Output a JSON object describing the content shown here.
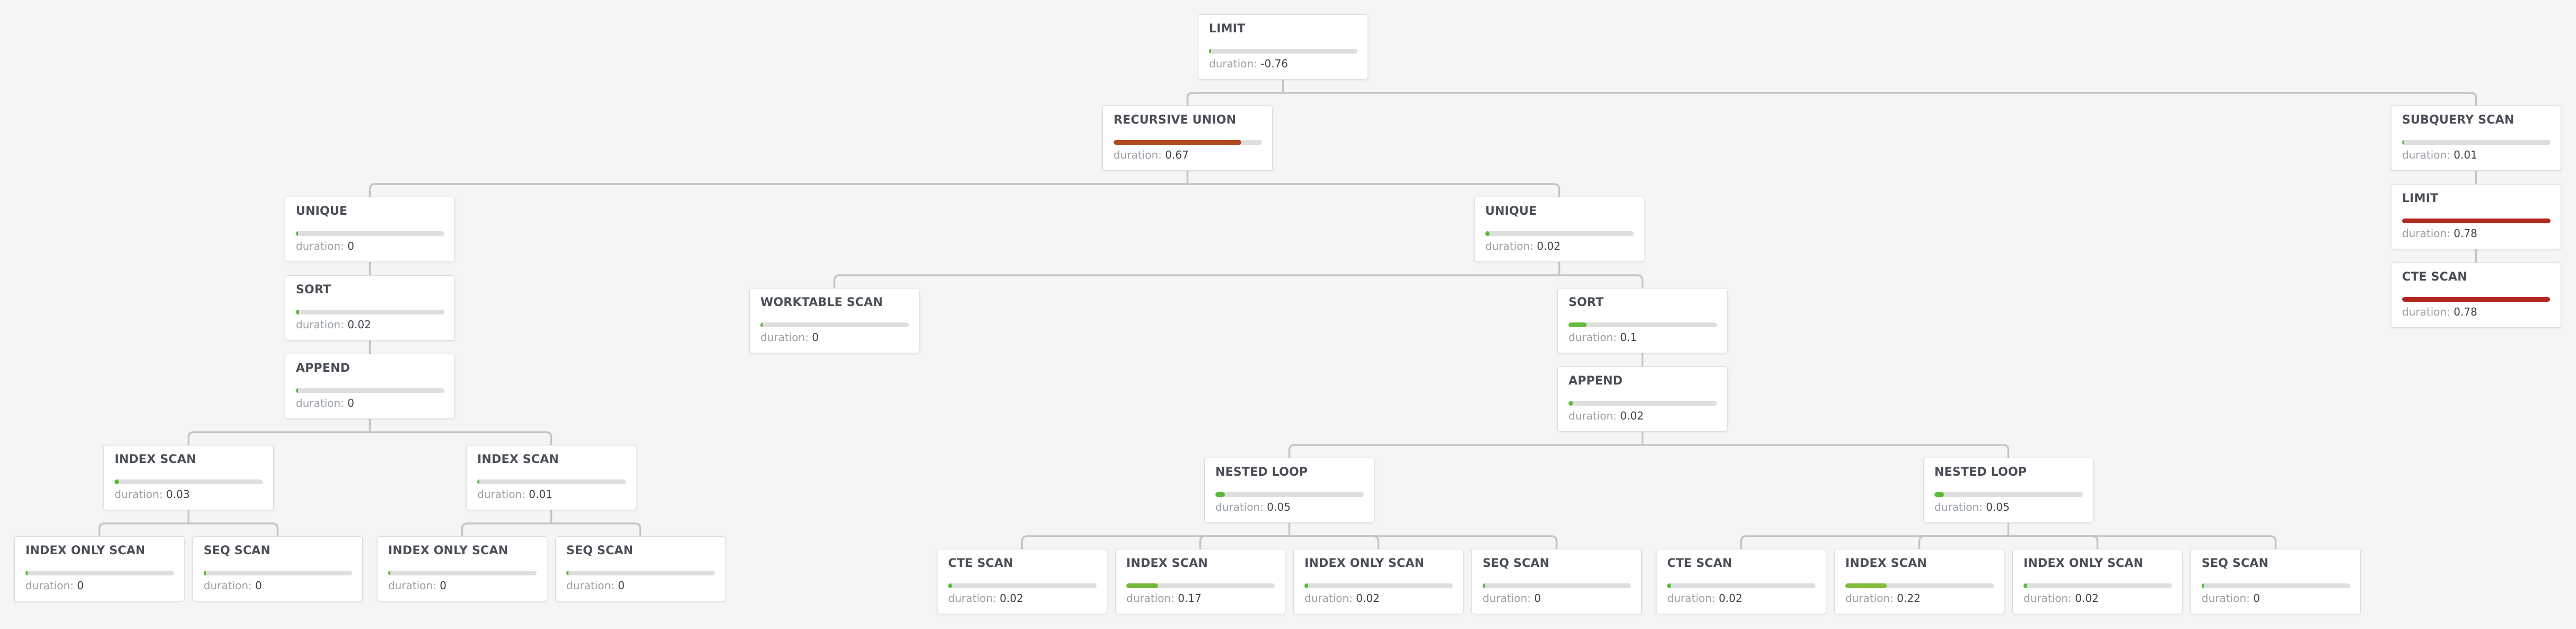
{
  "diagram": {
    "type": "query-plan-tree",
    "duration_label": "duration:",
    "colors": {
      "background": "#f5f5f5",
      "edge": "#c4c4c4",
      "bar_track": "#dedede",
      "bar_low": "#5cba3a",
      "bar_mid_low": "#72b83a",
      "bar_mid": "#84bc3c",
      "bar_high": "#b34a1f",
      "bar_max": "#b0281e"
    },
    "nodes": [
      {
        "id": "limit-root",
        "label": "LIMIT",
        "duration": "-0.76",
        "fraction": 0.0,
        "color": "#5cba3a",
        "parent": null
      },
      {
        "id": "recursive-union",
        "label": "RECURSIVE UNION",
        "duration": "0.67",
        "fraction": 0.86,
        "color": "#b34a1f",
        "parent": "limit-root"
      },
      {
        "id": "subquery-scan",
        "label": "SUBQUERY SCAN",
        "duration": "0.01",
        "fraction": 0.0,
        "color": "#5cba3a",
        "parent": "limit-root"
      },
      {
        "id": "limit-sub",
        "label": "LIMIT",
        "duration": "0.78",
        "fraction": 1.0,
        "color": "#b0281e",
        "parent": "subquery-scan"
      },
      {
        "id": "cte-scan-sub",
        "label": "CTE SCAN",
        "duration": "0.78",
        "fraction": 0.995,
        "color": "#b0281e",
        "parent": "limit-sub"
      },
      {
        "id": "unique-left",
        "label": "UNIQUE",
        "duration": "0",
        "fraction": 0.0,
        "color": "#5cba3a",
        "parent": "recursive-union"
      },
      {
        "id": "sort-left",
        "label": "SORT",
        "duration": "0.02",
        "fraction": 0.02,
        "color": "#5cba3a",
        "parent": "unique-left"
      },
      {
        "id": "append-left",
        "label": "APPEND",
        "duration": "0",
        "fraction": 0.0,
        "color": "#5cba3a",
        "parent": "sort-left"
      },
      {
        "id": "index-scan-a",
        "label": "INDEX SCAN",
        "duration": "0.03",
        "fraction": 0.03,
        "color": "#5cba3a",
        "parent": "append-left"
      },
      {
        "id": "index-only-scan-a",
        "label": "INDEX ONLY SCAN",
        "duration": "0",
        "fraction": 0.0,
        "color": "#5cba3a",
        "parent": "index-scan-a"
      },
      {
        "id": "seq-scan-a",
        "label": "SEQ SCAN",
        "duration": "0",
        "fraction": 0.0,
        "color": "#5cba3a",
        "parent": "index-scan-a"
      },
      {
        "id": "index-scan-b",
        "label": "INDEX SCAN",
        "duration": "0.01",
        "fraction": 0.0,
        "color": "#5cba3a",
        "parent": "append-left"
      },
      {
        "id": "index-only-scan-b",
        "label": "INDEX ONLY SCAN",
        "duration": "0",
        "fraction": 0.0,
        "color": "#5cba3a",
        "parent": "index-scan-b"
      },
      {
        "id": "seq-scan-b",
        "label": "SEQ SCAN",
        "duration": "0",
        "fraction": 0.0,
        "color": "#5cba3a",
        "parent": "index-scan-b"
      },
      {
        "id": "unique-right",
        "label": "UNIQUE",
        "duration": "0.02",
        "fraction": 0.03,
        "color": "#5cba3a",
        "parent": "recursive-union"
      },
      {
        "id": "worktable-scan",
        "label": "WORKTABLE SCAN",
        "duration": "0",
        "fraction": 0.0,
        "color": "#5cba3a",
        "parent": "unique-right"
      },
      {
        "id": "sort-right",
        "label": "SORT",
        "duration": "0.1",
        "fraction": 0.12,
        "color": "#65bb3c",
        "parent": "unique-right"
      },
      {
        "id": "append-right",
        "label": "APPEND",
        "duration": "0.02",
        "fraction": 0.03,
        "color": "#5cba3a",
        "parent": "sort-right"
      },
      {
        "id": "nested-loop-a",
        "label": "NESTED LOOP",
        "duration": "0.05",
        "fraction": 0.065,
        "color": "#5cba3a",
        "parent": "append-right"
      },
      {
        "id": "cte-scan-a",
        "label": "CTE SCAN",
        "duration": "0.02",
        "fraction": 0.025,
        "color": "#5cba3a",
        "parent": "nested-loop-a"
      },
      {
        "id": "index-scan-c",
        "label": "INDEX SCAN",
        "duration": "0.17",
        "fraction": 0.215,
        "color": "#72b83a",
        "parent": "nested-loop-a"
      },
      {
        "id": "index-only-scan-c",
        "label": "INDEX ONLY SCAN",
        "duration": "0.02",
        "fraction": 0.025,
        "color": "#5cba3a",
        "parent": "nested-loop-a"
      },
      {
        "id": "seq-scan-c",
        "label": "SEQ SCAN",
        "duration": "0",
        "fraction": 0.0,
        "color": "#5cba3a",
        "parent": "nested-loop-a"
      },
      {
        "id": "nested-loop-b",
        "label": "NESTED LOOP",
        "duration": "0.05",
        "fraction": 0.065,
        "color": "#5cba3a",
        "parent": "append-right"
      },
      {
        "id": "cte-scan-b",
        "label": "CTE SCAN",
        "duration": "0.02",
        "fraction": 0.025,
        "color": "#5cba3a",
        "parent": "nested-loop-b"
      },
      {
        "id": "index-scan-d",
        "label": "INDEX SCAN",
        "duration": "0.22",
        "fraction": 0.28,
        "color": "#84bc3c",
        "parent": "nested-loop-b"
      },
      {
        "id": "index-only-scan-d",
        "label": "INDEX ONLY SCAN",
        "duration": "0.02",
        "fraction": 0.025,
        "color": "#5cba3a",
        "parent": "nested-loop-b"
      },
      {
        "id": "seq-scan-d",
        "label": "SEQ SCAN",
        "duration": "0",
        "fraction": 0.0,
        "color": "#5cba3a",
        "parent": "nested-loop-b"
      }
    ]
  }
}
